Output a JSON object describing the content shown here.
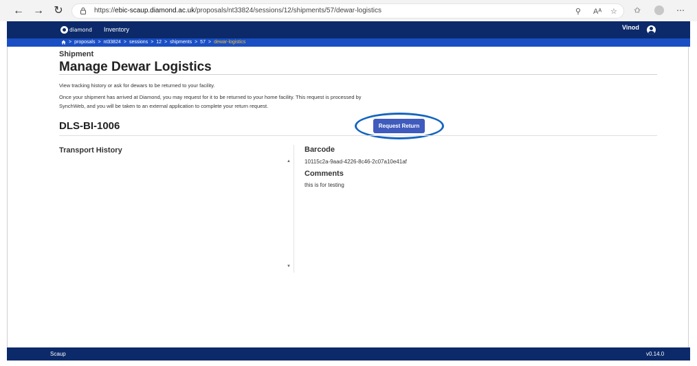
{
  "browser": {
    "url_prefix": "https://",
    "url_host": "ebic-scaup.diamond.ac.uk",
    "url_path": "/proposals/nt33824/sessions/12/shipments/57/dewar-logistics"
  },
  "header": {
    "logo_text": "diamond",
    "nav_item": "Inventory",
    "user_name": "Vinod"
  },
  "breadcrumb": {
    "items": [
      "proposals",
      "nt33824",
      "sessions",
      "12",
      "shipments",
      "57"
    ],
    "current": "dewar-logistics",
    "separator": ">"
  },
  "page": {
    "kicker": "Shipment",
    "title": "Manage Dewar Logistics",
    "intro_1": "View tracking history or ask for dewars to be returned to your facility.",
    "intro_2": "Once your shipment has arrived at Diamond, you may request for it to be returned to your home facility. This request is processed by",
    "intro_3": "SynchWeb, and you will be taken to an external application to complete your return request."
  },
  "dewar": {
    "code": "DLS-BI-1006",
    "request_label": "Request Return"
  },
  "transport": {
    "title": "Transport History"
  },
  "details": {
    "barcode_label": "Barcode",
    "barcode_value": "10115c2a-9aad-4226-8c46-2c07a10e41af",
    "comments_label": "Comments",
    "comments_value": "this is for testing"
  },
  "footer": {
    "left": "Scaup",
    "right": "v0.14.0"
  },
  "colors": {
    "header_bg": "#0c2a6a",
    "breadcrumb_bg": "#1a4fc4",
    "breadcrumb_current": "#f1c232",
    "button_bg": "#3f5bbd",
    "highlight_ring": "#1565c0"
  },
  "icons": [
    "back-arrow-icon",
    "forward-arrow-icon",
    "refresh-icon",
    "lock-icon",
    "zoom-icon",
    "read-aloud-icon",
    "favorite-star-icon",
    "collections-icon",
    "profile-icon",
    "more-icon",
    "home-icon",
    "user-avatar-icon"
  ]
}
